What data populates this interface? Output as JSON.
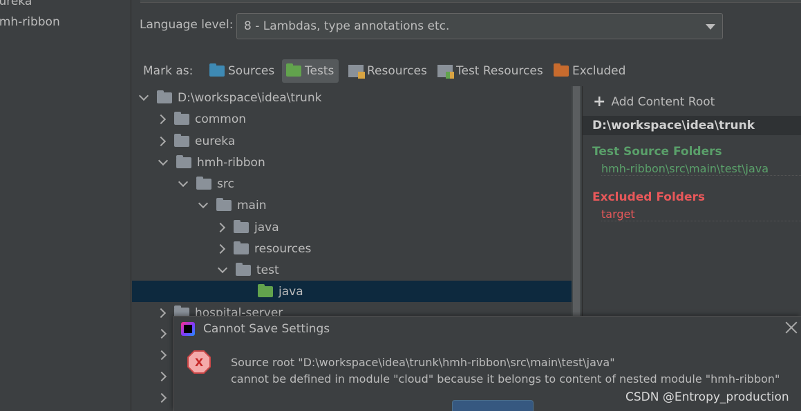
{
  "left_panel": {
    "items": [
      "eureka",
      "hmh-ribbon"
    ]
  },
  "language": {
    "label": "Language level:",
    "selected": "8 - Lambdas, type annotations etc."
  },
  "mark_as": {
    "label": "Mark as:",
    "buttons": [
      {
        "label": "Sources",
        "icon": "sources-folder-icon",
        "active": false
      },
      {
        "label": "Tests",
        "icon": "tests-folder-icon",
        "active": true
      },
      {
        "label": "Resources",
        "icon": "resources-folder-icon",
        "active": false
      },
      {
        "label": "Test Resources",
        "icon": "test-resources-folder-icon",
        "active": false
      },
      {
        "label": "Excluded",
        "icon": "excluded-folder-icon",
        "active": false
      }
    ]
  },
  "tree": {
    "rows": [
      {
        "label": "D:\\workspace\\idea\\trunk",
        "depth": 0,
        "state": "expanded",
        "kind": "gray"
      },
      {
        "label": "common",
        "depth": 1,
        "state": "collapsed",
        "kind": "gray"
      },
      {
        "label": "eureka",
        "depth": 1,
        "state": "collapsed",
        "kind": "gray"
      },
      {
        "label": "hmh-ribbon",
        "depth": 1,
        "state": "expanded",
        "kind": "gray"
      },
      {
        "label": "src",
        "depth": 2,
        "state": "expanded",
        "kind": "gray"
      },
      {
        "label": "main",
        "depth": 3,
        "state": "expanded",
        "kind": "gray"
      },
      {
        "label": "java",
        "depth": 4,
        "state": "collapsed",
        "kind": "gray"
      },
      {
        "label": "resources",
        "depth": 4,
        "state": "collapsed",
        "kind": "gray"
      },
      {
        "label": "test",
        "depth": 4,
        "state": "expanded",
        "kind": "gray"
      },
      {
        "label": "java",
        "depth": 5,
        "state": "leaf",
        "kind": "green",
        "selected": true
      },
      {
        "label": "hospital-server",
        "depth": 1,
        "state": "collapsed",
        "kind": "gray"
      }
    ]
  },
  "content_root": {
    "add_label": "Add Content Root",
    "root_path": "D:\\workspace\\idea\\trunk",
    "test_heading": "Test Source Folders",
    "test_path": "hmh-ribbon\\src\\main\\test\\java",
    "excluded_heading": "Excluded Folders",
    "excluded_path": "target"
  },
  "dialog": {
    "title": "Cannot Save Settings",
    "message_line1": "Source root \"D:\\workspace\\idea\\trunk\\hmh-ribbon\\src\\main\\test\\java\"",
    "message_line2": "cannot be defined in module \"cloud\" because it belongs to content of nested module \"hmh-ribbon\"",
    "error_icon_glyph": "X"
  },
  "watermark": "CSDN @Entropy_production",
  "colors": {
    "test_green": "#5aa06a",
    "excluded_red": "#e8585a",
    "selection": "#0d293e"
  }
}
